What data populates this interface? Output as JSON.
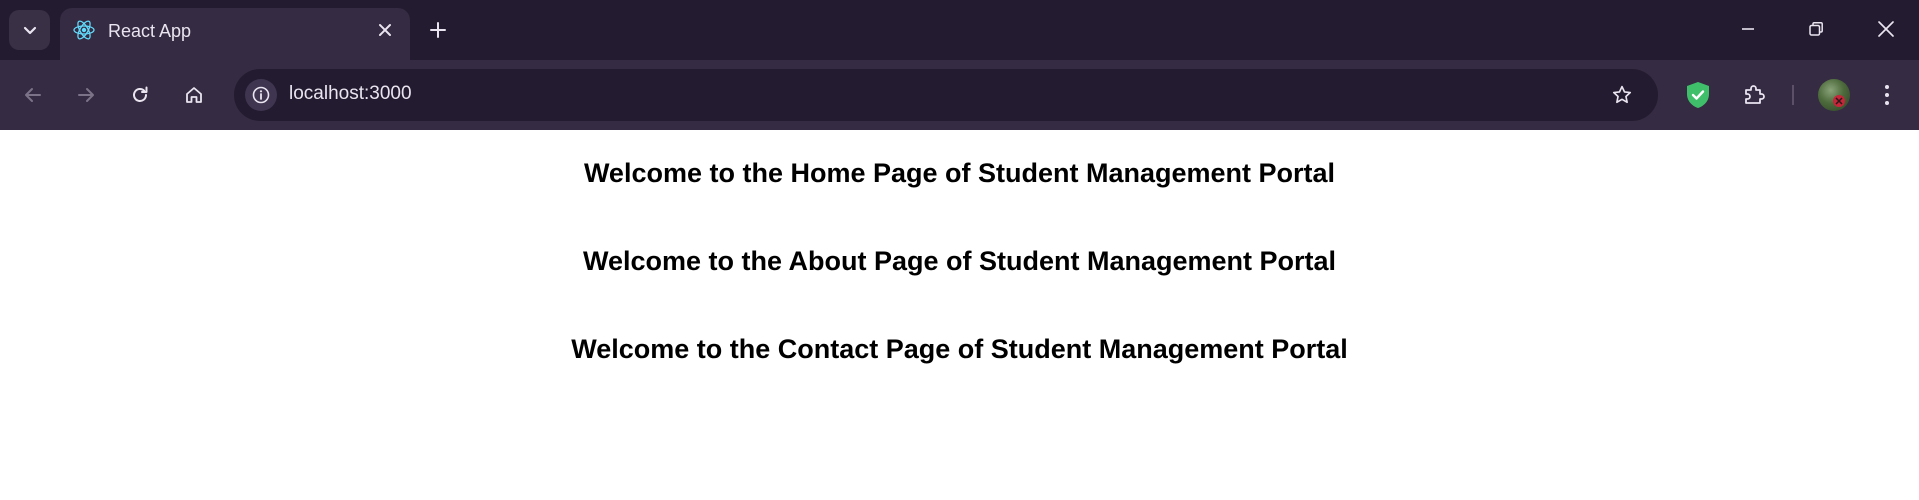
{
  "browser": {
    "tab": {
      "title": "React App",
      "favicon": "react-icon"
    },
    "address_bar": {
      "url": "localhost:3000"
    },
    "colors": {
      "frame": "#231b2f",
      "toolbar": "#352b42",
      "text": "#e9e4f0",
      "shield_green": "#3fbf6a"
    }
  },
  "page": {
    "headings": [
      "Welcome to the Home Page of Student Management Portal",
      "Welcome to the About Page of Student Management Portal",
      "Welcome to the Contact Page of Student Management Portal"
    ]
  }
}
